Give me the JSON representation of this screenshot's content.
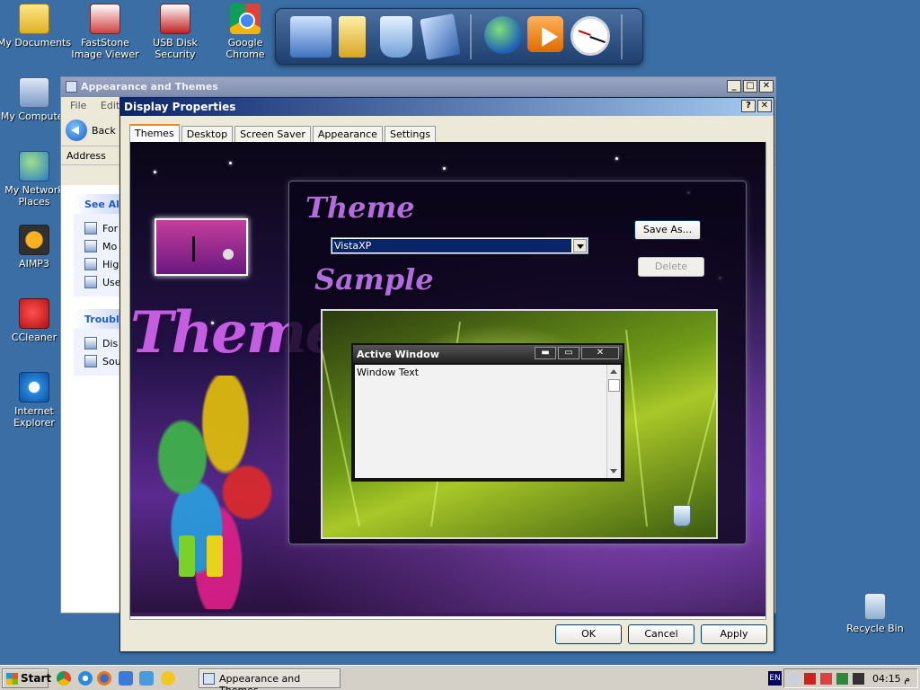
{
  "desktop": {
    "icons": [
      {
        "label": "My Documents"
      },
      {
        "label": "FastStone Image Viewer"
      },
      {
        "label": "USB Disk Security"
      },
      {
        "label": "Google Chrome"
      },
      {
        "label": "My Computer"
      },
      {
        "label": "My Network Places"
      },
      {
        "label": "AIMP3"
      },
      {
        "label": "CCleaner"
      },
      {
        "label": "Internet Explorer"
      },
      {
        "label": "Recycle Bin"
      }
    ]
  },
  "dock": {
    "items": [
      {
        "icon": "my-computer-icon"
      },
      {
        "icon": "folder-icon"
      },
      {
        "icon": "recycle-bin-icon"
      },
      {
        "icon": "display-icon"
      },
      {
        "icon": "globe-icon"
      },
      {
        "icon": "media-player-icon"
      },
      {
        "icon": "clock-icon"
      }
    ]
  },
  "explorer": {
    "title": "Appearance and Themes",
    "menu": [
      "File",
      "Edit"
    ],
    "back_label": "Back",
    "address_label": "Address",
    "see_also": {
      "header": "See Als",
      "items": [
        "For",
        "Mo",
        "Hig",
        "Use"
      ]
    },
    "troubleshooters": {
      "header": "Troubl",
      "items": [
        "Dis",
        "Sou"
      ]
    },
    "buttons": {
      "minimize": "_",
      "maximize": "□",
      "close": "✕"
    }
  },
  "dialog": {
    "title": "Display Properties",
    "help_button": "?",
    "close_button": "✕",
    "tabs": [
      "Themes",
      "Desktop",
      "Screen Saver",
      "Appearance",
      "Settings"
    ],
    "active_tab": "Themes",
    "theme_heading": "Theme",
    "theme_value": "VistaXP",
    "save_as_label": "Save As...",
    "delete_label": "Delete",
    "sample_heading": "Sample",
    "sample_window": {
      "title": "Active Window",
      "body_text": "Window Text",
      "controls": [
        "▬",
        "▭",
        "✕"
      ]
    },
    "art_heading": "Themes",
    "ok_label": "OK",
    "cancel_label": "Cancel",
    "apply_label": "Apply"
  },
  "taskbar": {
    "start_label": "Start",
    "task_label": "Appearance and Themes",
    "language": "EN",
    "time": "04:15 م"
  }
}
